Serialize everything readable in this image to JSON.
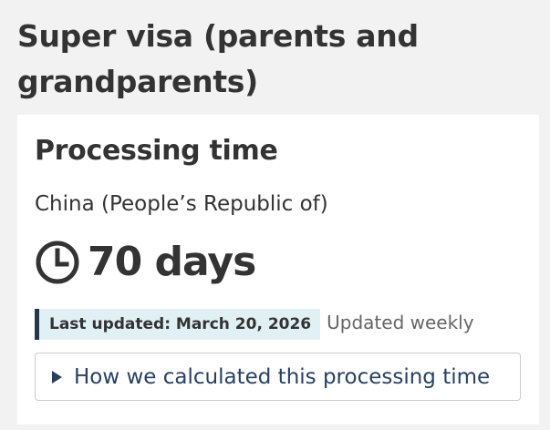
{
  "page": {
    "heading": "Super visa (parents and grandparents)"
  },
  "processing": {
    "title": "Processing time",
    "country": "China (People’s Republic of)",
    "time_value": "70 days",
    "time_icon": "clock-icon",
    "last_updated": "Last updated: March 20, 2026",
    "update_frequency": "Updated weekly",
    "details_toggle": {
      "label": "How we calculated this processing time",
      "icon": "triangle-right-icon",
      "expanded": false
    }
  },
  "colors": {
    "background": "#f2f2f2",
    "card": "#ffffff",
    "text": "#333333",
    "muted_text": "#666666",
    "link": "#284162",
    "badge_background": "#e1f0f5",
    "badge_border": "#26374a",
    "details_border": "#cccccc"
  }
}
